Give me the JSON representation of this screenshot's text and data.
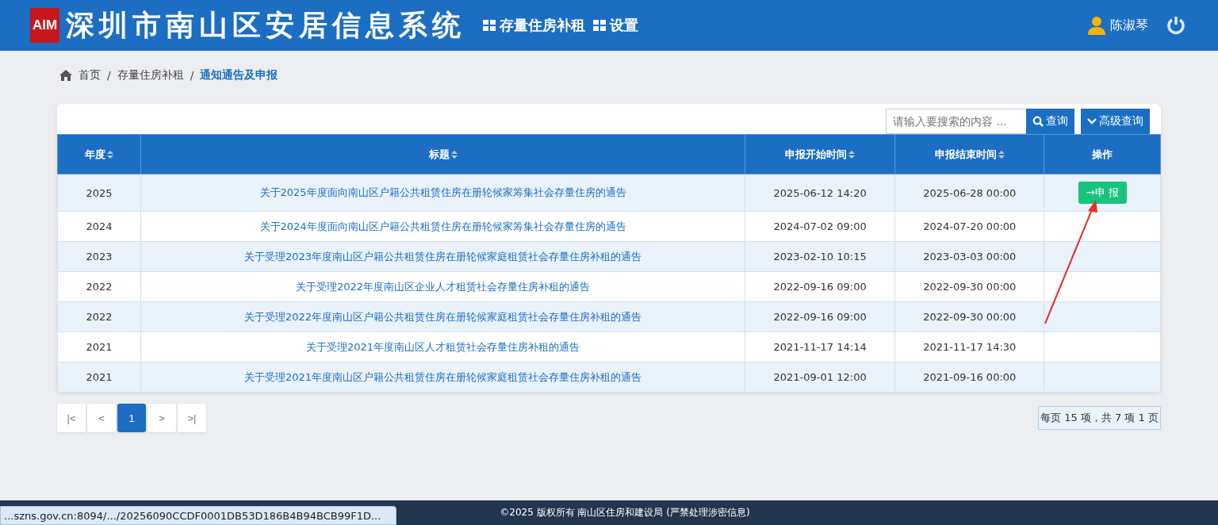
{
  "header": {
    "logo": "AIM",
    "title": "深圳市南山区安居信息系统",
    "nav": [
      "存量住房补租",
      "设置"
    ],
    "user": "陈淑琴"
  },
  "breadcrumb": {
    "items": [
      "首页",
      "存量住房补租",
      "通知通告及申报"
    ],
    "separator": "/"
  },
  "search": {
    "placeholder": "请输入要搜索的内容 ...",
    "button": "查询",
    "advanced": "高级查询"
  },
  "table": {
    "columns": [
      {
        "label": "年度",
        "sortable": true
      },
      {
        "label": "标题",
        "sortable": true
      },
      {
        "label": "申报开始时间",
        "sortable": true
      },
      {
        "label": "申报结束时间",
        "sortable": true
      },
      {
        "label": "操作",
        "sortable": false
      }
    ],
    "rows": [
      {
        "year": "2025",
        "title": "关于2025年度面向南山区户籍公共租赁住房在册轮候家筹集社会存量住房的通告",
        "start": "2025-06-12 14:20",
        "end": "2025-06-28 00:00",
        "action": "→申 报"
      },
      {
        "year": "2024",
        "title": "关于2024年度面向南山区户籍公共租赁住房在册轮候家筹集社会存量住房的通告",
        "start": "2024-07-02 09:00",
        "end": "2024-07-20 00:00"
      },
      {
        "year": "2023",
        "title": "关于受理2023年度南山区户籍公共租赁住房在册轮候家庭租赁社会存量住房补租的通告",
        "start": "2023-02-10 10:15",
        "end": "2023-03-03 00:00"
      },
      {
        "year": "2022",
        "title": "关于受理2022年度南山区企业人才租赁社会存量住房补租的通告",
        "start": "2022-09-16 09:00",
        "end": "2022-09-30 00:00"
      },
      {
        "year": "2022",
        "title": "关于受理2022年度南山区户籍公共租赁住房在册轮候家庭租赁社会存量住房补租的通告",
        "start": "2022-09-16 09:00",
        "end": "2022-09-30 00:00"
      },
      {
        "year": "2021",
        "title": "关于受理2021年度南山区人才租赁社会存量住房补租的通告",
        "start": "2021-11-17 14:14",
        "end": "2021-11-17 14:30"
      },
      {
        "year": "2021",
        "title": "关于受理2021年度南山区户籍公共租赁住房在册轮候家庭租赁社会存量住房补租的通告",
        "start": "2021-09-01 12:00",
        "end": "2021-09-16 00:00"
      }
    ]
  },
  "pagination": {
    "pages": [
      {
        "label": "|<",
        "selected": false
      },
      {
        "label": "<",
        "selected": false
      },
      {
        "label": "1",
        "selected": true
      },
      {
        "label": ">",
        "selected": false
      },
      {
        "label": ">|",
        "selected": false
      }
    ],
    "summary": "每页 15 项，共 7 项 1 页"
  },
  "footer": "©2025 版权所有 南山区住房和建设局 (严禁处理涉密信息)",
  "status_url": "...szns.gov.cn:8094/.../20256090CCDF0001DB53D186B4B94BCB99F1D..."
}
